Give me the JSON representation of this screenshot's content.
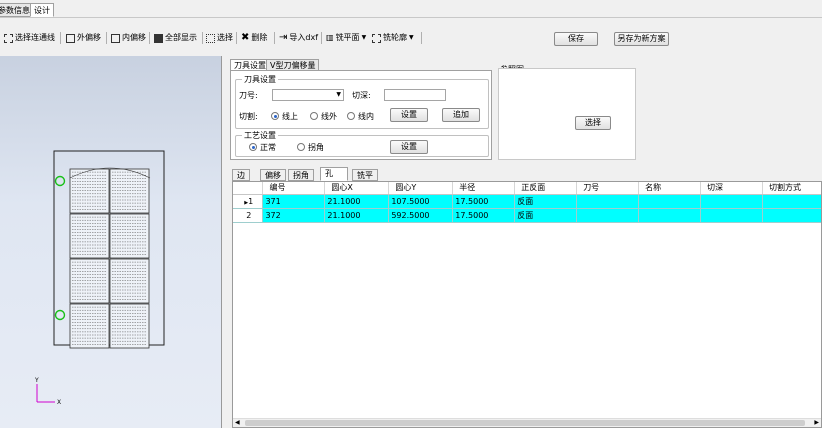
{
  "top_tabs": [
    "参数信息",
    "设计"
  ],
  "toolbar": {
    "select_connected": "选择连通线",
    "outer_offset": "外偏移",
    "inner_offset": "内偏移",
    "show_all": "全部显示",
    "select": "选择",
    "delete": "删除",
    "import_dxf": "导入dxf",
    "mill_plane": "铣平面",
    "mill_contour": "铣轮廓",
    "save": "保存",
    "save_as_new": "另存为新方案"
  },
  "settings_tabs": [
    "刀具设置",
    "V型刀偏移量"
  ],
  "tool_settings": {
    "group_label": "刀具设置",
    "tool_no_label": "刀号:",
    "cut_depth_label": "切深:",
    "cut_label": "切割:",
    "radios": [
      "线上",
      "线外",
      "线内"
    ],
    "selected_radio": 0,
    "settings_button": "设置",
    "add_button": "追加"
  },
  "process_settings": {
    "group_label": "工艺设置",
    "radios": [
      "正常",
      "拐角"
    ],
    "selected_radio": 0,
    "settings_button": "设置"
  },
  "reference": {
    "label": "参照图",
    "select_button": "选择"
  },
  "grid_tabs": [
    "边",
    "偏移",
    "拐角",
    "孔",
    "铣平"
  ],
  "active_grid_tab": 3,
  "grid": {
    "columns": [
      "编号",
      "圆心X",
      "圆心Y",
      "半径",
      "正反面",
      "刀号",
      "名称",
      "切深",
      "切割方式"
    ],
    "rows": [
      {
        "row_header": "1",
        "cells": [
          "371",
          "21.1000",
          "107.5000",
          "17.5000",
          "反面",
          "",
          "",
          "",
          ""
        ]
      },
      {
        "row_header": "2",
        "cells": [
          "372",
          "21.1000",
          "592.5000",
          "17.5000",
          "反面",
          "",
          "",
          "",
          ""
        ]
      }
    ]
  },
  "axes": {
    "x": "X",
    "y": "Y"
  },
  "colors": {
    "selected_row": "#00ffff",
    "hole_marker": "#18c018",
    "axis": "#d000d0"
  }
}
